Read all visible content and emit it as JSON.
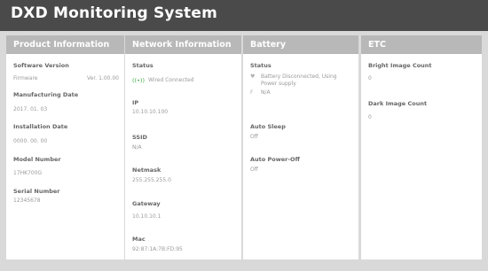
{
  "title": "DXD Monitoring System",
  "product": {
    "heading": "Product Information",
    "software_label": "Software Version",
    "firmware_label": "Firmware",
    "firmware_value": "Ver. 1.00.00",
    "manufacturing_label": "Manufacturing Date",
    "manufacturing_value": "2017. 01. 03",
    "installation_label": "Installation Date",
    "installation_value": "0000. 00. 00",
    "model_label": "Model Number",
    "model_value": "17HK700G",
    "serial_label": "Serial Number",
    "serial_value": "12345678"
  },
  "network": {
    "heading": "Network Information",
    "status_label": "Status",
    "status_icon": "wired-connected-icon",
    "status_value": "Wired Connected",
    "ip_label": "IP",
    "ip_value": "10.10.10.100",
    "ssid_label": "SSID",
    "ssid_value": "N/A",
    "netmask_label": "Netmask",
    "netmask_value": "255.255.255.0",
    "gateway_label": "Gateway",
    "gateway_value": "10.10.10.1",
    "mac_label": "Mac",
    "mac_value": "92:87:1A:7B:FD:95"
  },
  "battery": {
    "heading": "Battery",
    "status_label": "Status",
    "status_line1": "Battery Disconnected, Using Power supply",
    "status_line2": "N/A",
    "auto_sleep_label": "Auto Sleep",
    "auto_sleep_value": "Off",
    "auto_poweroff_label": "Auto Power-Off",
    "auto_poweroff_value": "Off"
  },
  "etc": {
    "heading": "ETC",
    "bright_label": "Bright Image Count",
    "bright_value": "0",
    "dark_label": "Dark Image Count",
    "dark_value": "0"
  },
  "colors": {
    "header_bg": "#4a4a4a",
    "panel_header_bg": "#b8b8b8",
    "connected_green": "#3fae47"
  }
}
